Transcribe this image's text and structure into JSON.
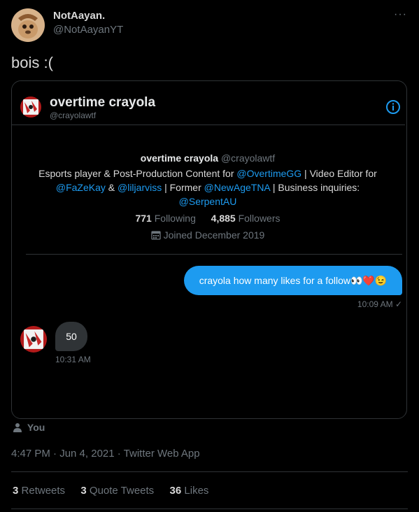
{
  "tweet": {
    "author_name": "NotAayan.",
    "author_handle": "@NotAayanYT",
    "text": "bois :(",
    "timestamp": "4:47 PM · Jun 4, 2021 · Twitter Web App",
    "stats": {
      "retweets_count": "3",
      "retweets_label": "Retweets",
      "quote_count": "3",
      "quote_label": "Quote Tweets",
      "likes_count": "36",
      "likes_label": "Likes"
    }
  },
  "screenshot": {
    "header_name": "overtime crayola",
    "header_handle": "@crayolawtf",
    "profile": {
      "name": "overtime crayola",
      "handle": "@crayolawtf",
      "bio_1": "Esports player & Post-Production Content for ",
      "bio_mention_1": "@OvertimeGG",
      "bio_2": " | Video Editor for",
      "bio_mention_2": "@FaZeKay",
      "bio_3": " & ",
      "bio_mention_3": "@liljarviss",
      "bio_4": " | Former ",
      "bio_mention_4": "@NewAgeTNA",
      "bio_5": " | Business inquiries:",
      "bio_mention_5": "@SerpentAU",
      "following_count": "771",
      "following_label": "Following",
      "followers_count": "4,885",
      "followers_label": "Followers",
      "joined": "Joined December 2019"
    },
    "sent_message": "crayola how many likes for a follow👀❤️😉",
    "sent_time": "10:09 AM ✓",
    "received_message": "50",
    "received_time": "10:31 AM"
  },
  "you_label": "You",
  "colors": {
    "accent": "#1d9bf0",
    "bubble_sent": "#1d9bf0",
    "bubble_received": "#2f3336"
  }
}
